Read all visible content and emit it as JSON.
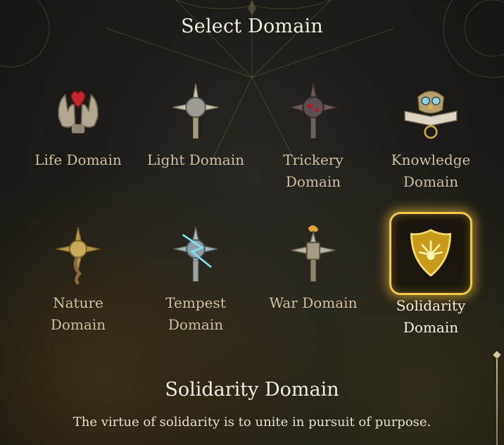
{
  "screen": {
    "title": "Select Domain"
  },
  "domains": [
    {
      "label": "Life Domain",
      "icon": "life-domain-icon",
      "selected": false
    },
    {
      "label": "Light Domain",
      "icon": "light-domain-icon",
      "selected": false
    },
    {
      "label": "Trickery Domain",
      "icon": "trickery-domain-icon",
      "selected": false
    },
    {
      "label": "Knowledge Domain",
      "icon": "knowledge-domain-icon",
      "selected": false
    },
    {
      "label": "Nature Domain",
      "icon": "nature-domain-icon",
      "selected": false
    },
    {
      "label": "Tempest Domain",
      "icon": "tempest-domain-icon",
      "selected": false
    },
    {
      "label": "War Domain",
      "icon": "war-domain-icon",
      "selected": false
    },
    {
      "label": "Solidarity Domain",
      "icon": "solidarity-domain-icon",
      "selected": true
    }
  ],
  "description": {
    "title": "Solidarity Domain",
    "text": "The virtue of solidarity is to unite in pursuit of purpose."
  },
  "colors": {
    "selection_border": "#f0c94a",
    "label_default": "#cdbfa4",
    "label_selected": "#f3efe5"
  }
}
